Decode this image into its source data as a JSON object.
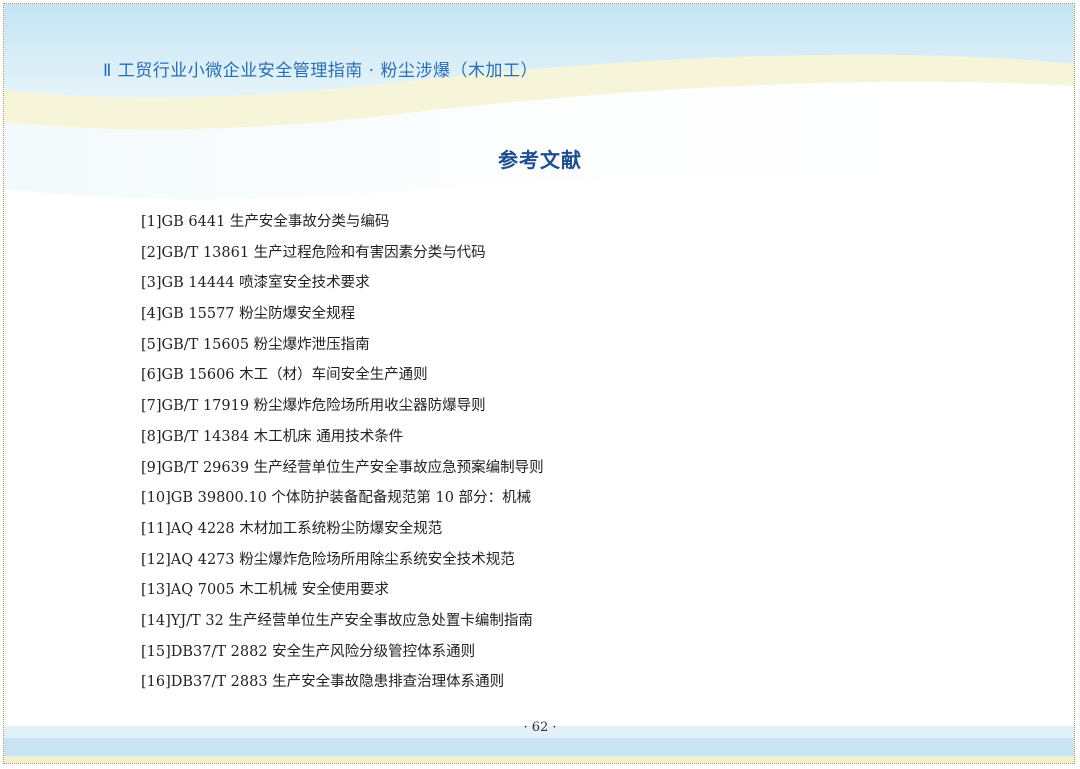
{
  "header": {
    "title": "Ⅱ 工贸行业小微企业安全管理指南  · 粉尘涉爆（木加工）"
  },
  "document": {
    "title": "参考文献",
    "references": [
      "[1]GB 6441 生产安全事故分类与编码",
      "[2]GB/T 13861 生产过程危险和有害因素分类与代码",
      "[3]GB 14444 喷漆室安全技术要求",
      "[4]GB 15577 粉尘防爆安全规程",
      "[5]GB/T 15605 粉尘爆炸泄压指南",
      "[6]GB 15606 木工（材）车间安全生产通则",
      "[7]GB/T 17919 粉尘爆炸危险场所用收尘器防爆导则",
      "[8]GB/T 14384 木工机床 通用技术条件",
      "[9]GB/T 29639 生产经营单位生产安全事故应急预案编制导则",
      "[10]GB 39800.10 个体防护装备配备规范第 10 部分：机械",
      "[11]AQ 4228 木材加工系统粉尘防爆安全规范",
      "[12]AQ 4273 粉尘爆炸危险场所用除尘系统安全技术规范",
      "[13]AQ 7005 木工机械 安全使用要求",
      "[14]YJ/T 32 生产经营单位生产安全事故应急处置卡编制指南",
      "[15]DB37/T 2882 安全生产风险分级管控体系通则",
      "[16]DB37/T 2883 生产安全事故隐患排查治理体系通则"
    ],
    "page_number": "· 62 ·"
  },
  "colors": {
    "header_text": "#2a6eb0",
    "title_text": "#1f4e8e",
    "band_light_blue": "#d6ecf6",
    "band_yellow": "#f6f3d2",
    "frame_border": "#b98a5c"
  }
}
